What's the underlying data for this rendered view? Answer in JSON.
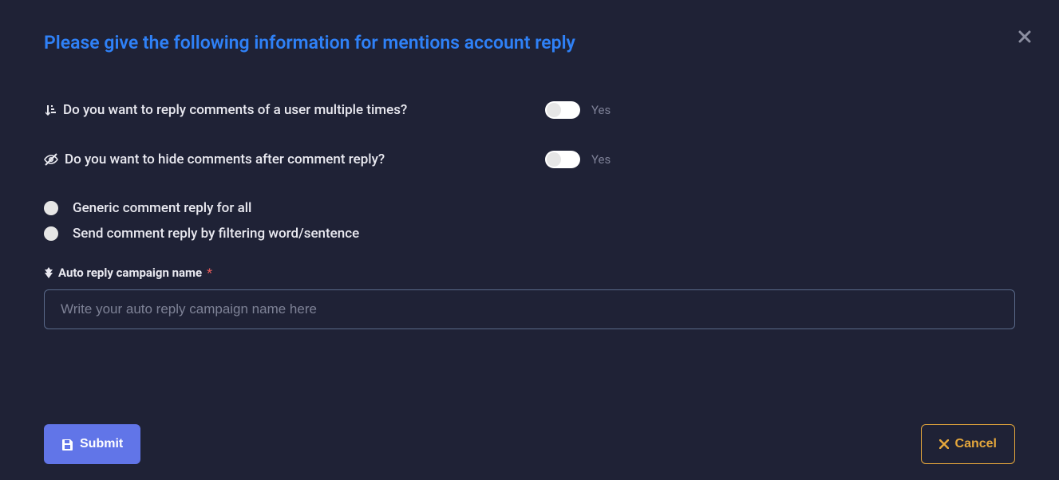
{
  "title": "Please give the following information for mentions account reply",
  "questions": {
    "reply_multiple": {
      "label": "Do you want to reply comments of a user multiple times?",
      "toggle_text": "Yes"
    },
    "hide_comments": {
      "label": "Do you want to hide comments after comment reply?",
      "toggle_text": "Yes"
    }
  },
  "reply_mode": {
    "generic": "Generic comment reply for all",
    "filtered": "Send comment reply by filtering word/sentence"
  },
  "campaign": {
    "label": "Auto reply campaign name",
    "required_mark": "*",
    "placeholder": "Write your auto reply campaign name here",
    "value": ""
  },
  "buttons": {
    "submit": "Submit",
    "cancel": "Cancel"
  }
}
